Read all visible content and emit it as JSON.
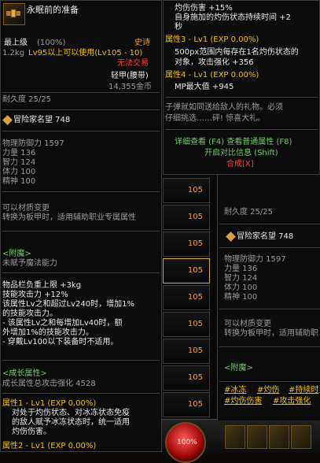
{
  "left": {
    "item_name": "永眠前的准备",
    "level_label": "最上级",
    "level_pct": "(100%)",
    "rarity": "史诗",
    "weight": "1.2kg",
    "usable": "Lv95以上可以使用(Lv105 - 10)",
    "trade": "无法交易",
    "type": "轻甲(腰带)",
    "price": "14,355金币",
    "durability": "耐久度 25/25",
    "guild_fame": "冒险家名望 748",
    "stats": [
      "物理防御力 1597",
      "力量 136",
      "智力 124",
      "体力 100",
      "精神 100"
    ],
    "material_change": "可以材质变更",
    "material_desc": "转换为板甲时，适用辅助职业专属属性",
    "enchant_header": "<附魔>",
    "enchant_desc": "未赋予魔法能力",
    "effects": [
      "物品栏负重上限 +3kg",
      "技能攻击力 +12%",
      "该属性Lv之和超过Lv240时，增加1%",
      "的技能攻击力。",
      "- 该属性Lv之和每增加Lv40时，额",
      "外增加1%的技能攻击力。",
      "- 穿戴Lv100以下装备时不适用。"
    ],
    "growth_header": "<成长属性>",
    "growth_total": "成长属性总攻击强化 4528",
    "attr1_title": "属性1 - Lv1 (EXP 0.00%)",
    "attr1_lines": [
      "对处于灼伤状态、对冰冻状态免疫",
      "的敌人赋予冰冻状态时，统一适用",
      "灼伤伤害。"
    ],
    "attr2_title": "属性2 - Lv1 (EXP 0.00%)"
  },
  "right_top": {
    "lines": [
      "灼伤伤害 +15%",
      "自身施加的灼伤状态持续时间 +2",
      "秒",
      "属性3 - Lv1 (EXP 0.00%)",
      "500px范围内每存在1名灼伤状态的",
      "对象，攻击强化 +356",
      "属性4 - Lv1 (EXP 0.00%)",
      "MP最大值 +945"
    ],
    "flavor": [
      "子弹就如同送给敌人的礼物。必须",
      "仔细挑选……砰! 惊喜大礼。"
    ],
    "view_common": "详细查看 (F4) 查看普通属性 (F8)",
    "compare": "开启对比信息 (Shift)",
    "synth": "合成[X]"
  },
  "slots": [
    "105",
    "105",
    "105",
    "105",
    "105",
    "105",
    "105",
    "105",
    "105"
  ],
  "right_bottom": {
    "durability": "耐久度 25/25",
    "guild_fame": "冒险家名望 748",
    "stats": [
      "物理防御力 1597",
      "力量 136",
      "智力 124",
      "体力 100",
      "精神 100"
    ],
    "material_change": "可以材质变更",
    "material_desc": "转换为板甲时，适用辅助职",
    "enchant_header": "<附魔>",
    "tags_row1": [
      "#冰冻",
      "#灼伤",
      "#持续时"
    ],
    "tags_row2": [
      "#灼伤伤害",
      "#攻击强化"
    ]
  },
  "hud": {
    "hp": "100%"
  }
}
